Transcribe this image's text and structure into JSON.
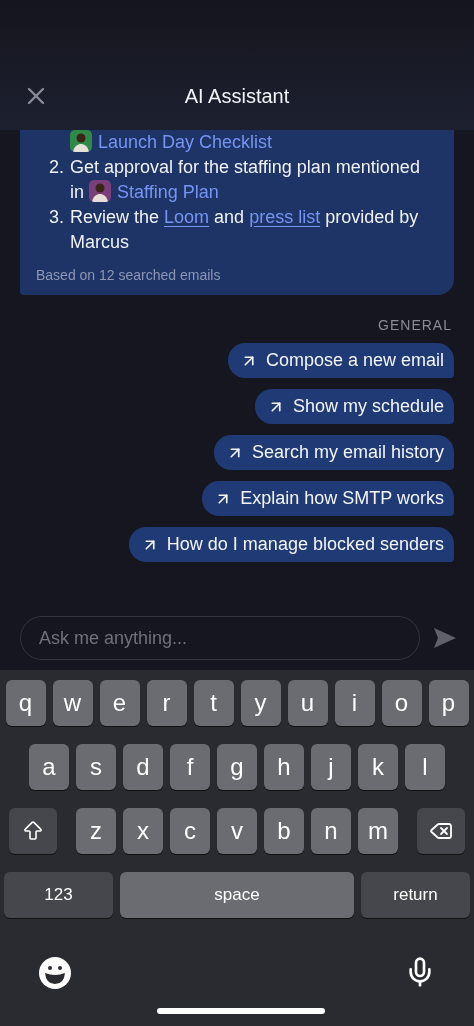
{
  "header": {
    "title": "AI Assistant"
  },
  "message": {
    "items": [
      {
        "segments": [
          {
            "kind": "doc",
            "text": "Launch Day Checklist"
          }
        ]
      },
      {
        "number": "2.",
        "segments": [
          {
            "kind": "text",
            "text": "Get approval for the staffing plan mentioned in "
          },
          {
            "kind": "doc",
            "text": "Staffing Plan"
          }
        ]
      },
      {
        "number": "3.",
        "segments": [
          {
            "kind": "text",
            "text": "Review the "
          },
          {
            "kind": "link",
            "text": "Loom"
          },
          {
            "kind": "text",
            "text": " and "
          },
          {
            "kind": "link",
            "text": "press list"
          },
          {
            "kind": "text",
            "text": " provided by Marcus"
          }
        ]
      }
    ],
    "footnote": "Based on 12 searched emails"
  },
  "section_label": "GENERAL",
  "suggestions": [
    "Compose a new email",
    "Show my schedule",
    "Search my email history",
    "Explain how SMTP works",
    "How do I manage blocked senders"
  ],
  "input": {
    "placeholder": "Ask me anything..."
  },
  "keyboard": {
    "rows": [
      [
        "q",
        "w",
        "e",
        "r",
        "t",
        "y",
        "u",
        "i",
        "o",
        "p"
      ],
      [
        "a",
        "s",
        "d",
        "f",
        "g",
        "h",
        "j",
        "k",
        "l"
      ],
      [
        "z",
        "x",
        "c",
        "v",
        "b",
        "n",
        "m"
      ]
    ],
    "numbers_key": "123",
    "space_key": "space",
    "return_key": "return"
  }
}
